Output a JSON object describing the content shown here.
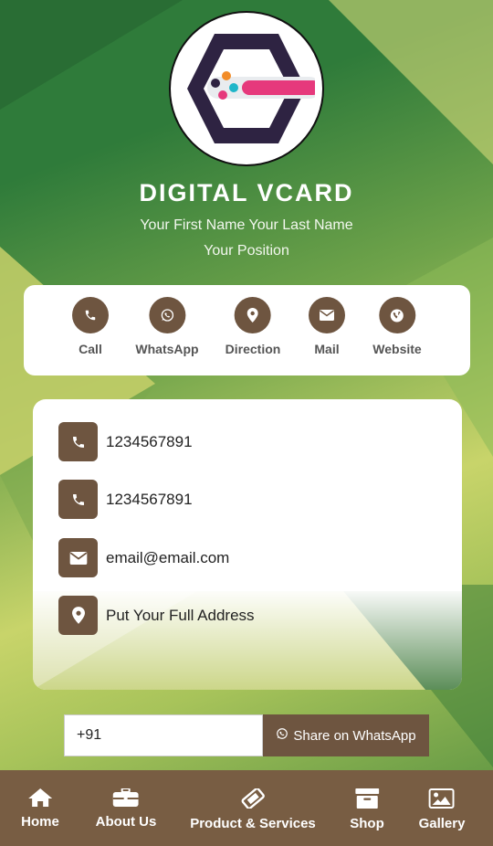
{
  "header": {
    "title": "DIGITAL VCARD",
    "name": "Your First Name Your Last Name",
    "position": "Your Position"
  },
  "actions": [
    {
      "label": "Call",
      "icon": "phone-icon"
    },
    {
      "label": "WhatsApp",
      "icon": "whatsapp-icon"
    },
    {
      "label": "Direction",
      "icon": "map-marker-icon"
    },
    {
      "label": "Mail",
      "icon": "envelope-icon"
    },
    {
      "label": "Website",
      "icon": "globe-icon"
    }
  ],
  "contact": {
    "phone1": "1234567891",
    "phone2": "1234567891",
    "email": "email@email.com",
    "address": "Put Your Full Address"
  },
  "share": {
    "phone_value": "+91",
    "button_label": "Share on WhatsApp"
  },
  "nav": [
    {
      "label": "Home",
      "icon": "home-icon"
    },
    {
      "label": "About Us",
      "icon": "briefcase-icon"
    },
    {
      "label": "Product & Services",
      "icon": "ticket-icon"
    },
    {
      "label": "Shop",
      "icon": "archive-icon"
    },
    {
      "label": "Gallery",
      "icon": "image-icon"
    }
  ],
  "colors": {
    "accent": "#6e5540",
    "nav_bg": "#785d43",
    "bg_dark": "#2f7b3a",
    "bg_light": "#c8d46a",
    "logo_dark": "#2e2342",
    "logo_pink": "#e6397c"
  }
}
